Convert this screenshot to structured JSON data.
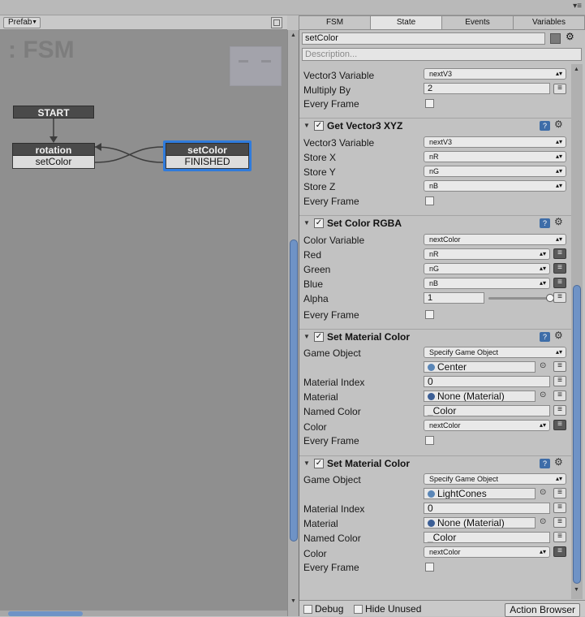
{
  "graph": {
    "prefab_label": "Prefab",
    "fsm_title": ": FSM",
    "nodes": {
      "start": "START",
      "rotation": {
        "name": "rotation",
        "event": "setColor"
      },
      "setcolor": {
        "name": "setColor",
        "event": "FINISHED"
      }
    }
  },
  "tabs": [
    "FSM",
    "State",
    "Events",
    "Variables"
  ],
  "state": {
    "name": "setColor",
    "description_placeholder": "Description..."
  },
  "partial_action": {
    "rows": [
      {
        "label": "Vector3  Variable",
        "value": "nextV3"
      },
      {
        "label": "Multiply By",
        "value": "2"
      },
      {
        "label": "Every Frame"
      }
    ]
  },
  "actions": [
    {
      "title": "Get Vector3 XYZ",
      "rows": [
        {
          "label": "Vector3  Variable",
          "value": "nextV3"
        },
        {
          "label": "Store X",
          "value": "nR"
        },
        {
          "label": "Store Y",
          "value": "nG"
        },
        {
          "label": "Store Z",
          "value": "nB"
        },
        {
          "label": "Every Frame"
        }
      ]
    },
    {
      "title": "Set Color RGBA",
      "rows": [
        {
          "label": "Color Variable",
          "value": "nextColor"
        },
        {
          "label": "Red",
          "value": "nR"
        },
        {
          "label": "Green",
          "value": "nG"
        },
        {
          "label": "Blue",
          "value": "nB"
        },
        {
          "label": "Alpha",
          "value": "1"
        },
        {
          "label": "Every Frame"
        }
      ]
    },
    {
      "title": "Set Material Color",
      "rows": [
        {
          "label": "Game Object",
          "value": "Specify Game Object"
        },
        {
          "label": "",
          "value": "Center"
        },
        {
          "label": "Material Index",
          "value": "0"
        },
        {
          "label": "Material",
          "value": "None (Material)"
        },
        {
          "label": "Named Color",
          "value": "_Color"
        },
        {
          "label": "Color",
          "value": "nextColor"
        },
        {
          "label": "Every Frame"
        }
      ]
    },
    {
      "title": "Set Material Color",
      "rows": [
        {
          "label": "Game Object",
          "value": "Specify Game Object"
        },
        {
          "label": "",
          "value": "LightCones"
        },
        {
          "label": "Material Index",
          "value": "0"
        },
        {
          "label": "Material",
          "value": "None (Material)"
        },
        {
          "label": "Named Color",
          "value": "_Color"
        },
        {
          "label": "Color",
          "value": "nextColor"
        },
        {
          "label": "Every Frame"
        }
      ]
    }
  ],
  "slider": {
    "alpha_fraction": 1
  },
  "bottom": {
    "debug": "Debug",
    "hide_unused": "Hide Unused",
    "action_browser": "Action Browser"
  },
  "icons": {
    "gear": "gear-icon",
    "help": "help-book-icon",
    "menu": "menu-icon"
  },
  "colors": {
    "selection": "#2f7bdc",
    "scroll_thumb": "#6f93c6",
    "node_header": "#4a4a4a"
  }
}
